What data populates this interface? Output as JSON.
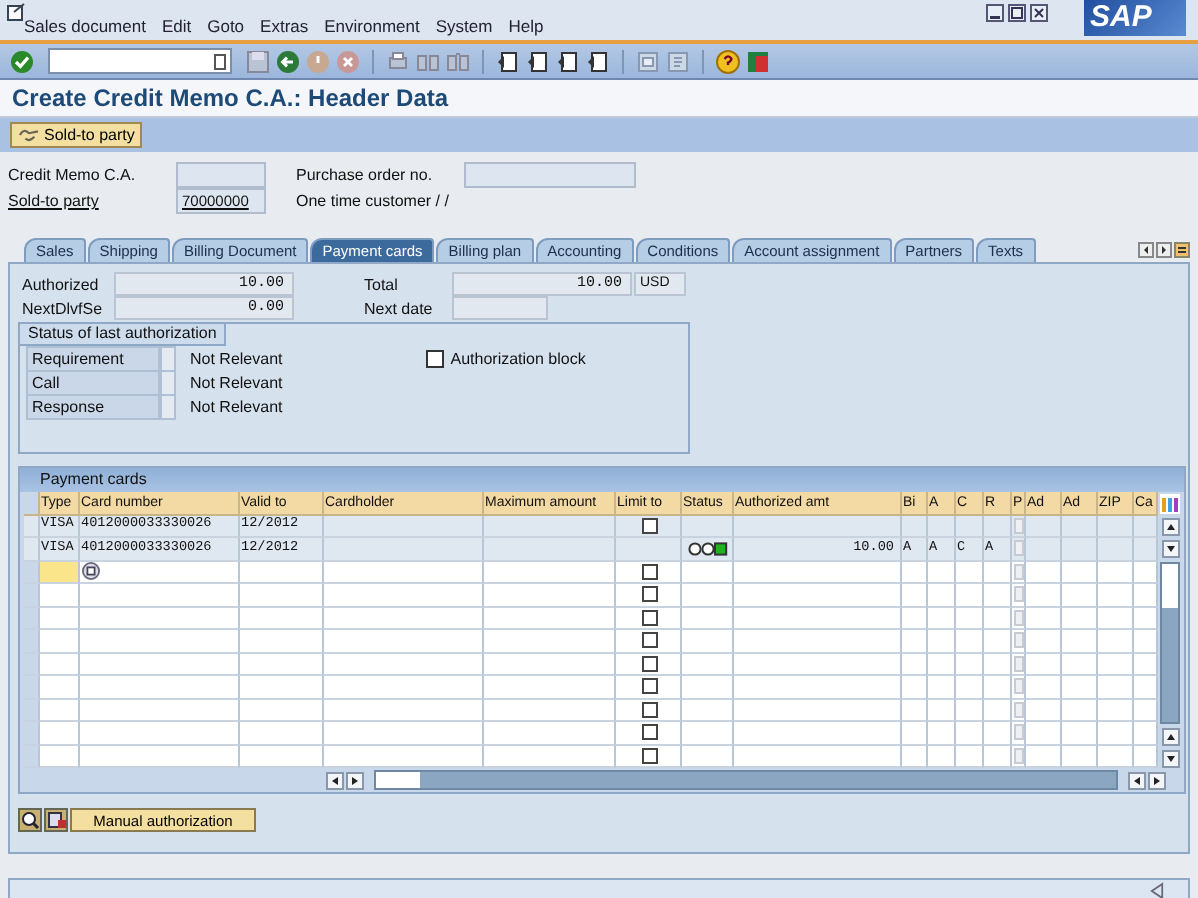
{
  "menu": [
    "Sales document",
    "Edit",
    "Goto",
    "Extras",
    "Environment",
    "System",
    "Help"
  ],
  "logo": "SAP",
  "title": "Create Credit Memo C.A.: Header Data",
  "app_toolbar": {
    "button": "Sold-to party"
  },
  "header": {
    "credit_memo_label": "Credit Memo C.A.",
    "sold_to_label": "Sold-to party",
    "sold_to_value": "70000000",
    "po_label": "Purchase order no.",
    "customer": "One time customer / /"
  },
  "tabs": [
    {
      "label": "Sales",
      "selected": false
    },
    {
      "label": "Shipping",
      "selected": false
    },
    {
      "label": "Billing Document",
      "selected": false
    },
    {
      "label": "Payment cards",
      "selected": true
    },
    {
      "label": "Billing plan",
      "selected": false
    },
    {
      "label": "Accounting",
      "selected": false
    },
    {
      "label": "Conditions",
      "selected": false
    },
    {
      "label": "Account assignment",
      "selected": false
    },
    {
      "label": "Partners",
      "selected": false
    },
    {
      "label": "Texts",
      "selected": false
    }
  ],
  "amounts": {
    "authorized_label": "Authorized",
    "authorized": "10.00",
    "next_label": "NextDlvfSe",
    "next": "0.00",
    "total_label": "Total",
    "total": "10.00",
    "currency": "USD",
    "next_date_label": "Next date"
  },
  "status_group": {
    "title": "Status of last authorization",
    "rows": [
      {
        "label": "Requirement",
        "value": "Not Relevant"
      },
      {
        "label": "Call",
        "value": "Not Relevant"
      },
      {
        "label": "Response",
        "value": "Not Relevant"
      }
    ],
    "block": {
      "label": "Authorization block",
      "checked": false
    }
  },
  "table": {
    "title": "Payment cards",
    "columns": [
      "Type",
      "Card number",
      "Valid to",
      "Cardholder",
      "Maximum amount",
      "Limit to",
      "Status",
      "Authorized amt",
      "Bi",
      "A",
      "C",
      "R",
      "P",
      "Ad",
      "Ad",
      "ZIP",
      "Ca"
    ],
    "rows": [
      {
        "kind": "card",
        "type": "VISA",
        "card_number": "4012000033330026",
        "valid_to": "12/2012",
        "limit_to_checked": false,
        "p_checked": false
      },
      {
        "kind": "card",
        "type": "VISA",
        "card_number": "4012000033330026",
        "valid_to": "12/2012",
        "color": "#22b022",
        "authorized_amt": "10.00",
        "bi": "A",
        "a": "A",
        "c": "C",
        "r": "A",
        "p_checked": false
      },
      {
        "kind": "input",
        "limit_to_checked": false,
        "p_checked": false
      },
      {
        "kind": "empty",
        "limit_to_checked": false,
        "p_checked": false
      },
      {
        "kind": "empty",
        "limit_to_checked": false,
        "p_checked": false
      },
      {
        "kind": "empty",
        "limit_to_checked": false,
        "p_checked": false
      },
      {
        "kind": "empty",
        "limit_to_checked": false,
        "p_checked": false
      },
      {
        "kind": "empty",
        "limit_to_checked": false,
        "p_checked": false
      },
      {
        "kind": "empty",
        "limit_to_checked": false,
        "p_checked": false
      },
      {
        "kind": "empty",
        "limit_to_checked": false,
        "p_checked": false
      },
      {
        "kind": "empty",
        "limit_to_checked": false,
        "p_checked": false
      }
    ]
  },
  "manual_button": "Manual authorization"
}
